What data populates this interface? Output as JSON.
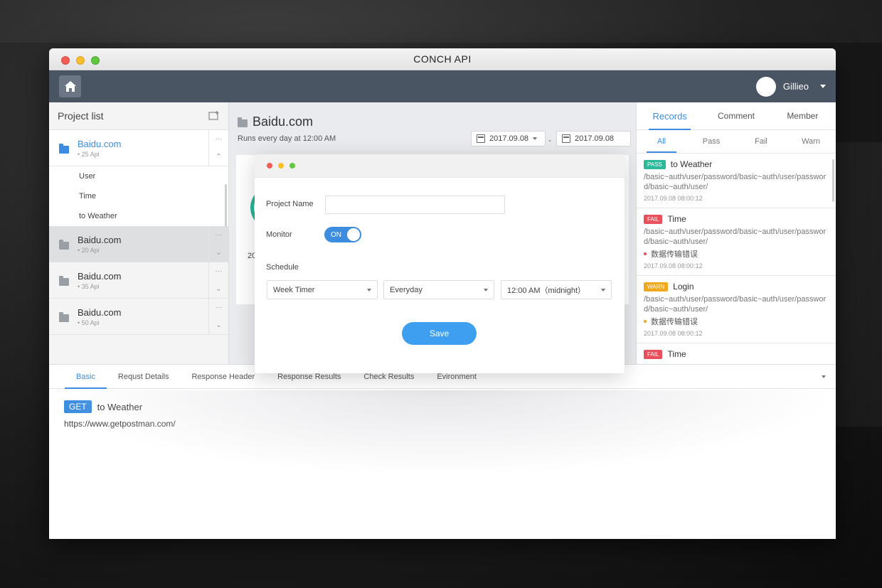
{
  "window": {
    "title": "CONCH API"
  },
  "appbar": {
    "user_name": "Gillieo"
  },
  "sidebar": {
    "title": "Project list",
    "projects": [
      {
        "name": "Baidu.com",
        "meta": "25 Api"
      },
      {
        "name": "Baidu.com",
        "meta": "20 Api"
      },
      {
        "name": "Baidu.com",
        "meta": "35 Api"
      },
      {
        "name": "Baidu.com",
        "meta": "50 Api"
      }
    ],
    "sub_items": [
      "User",
      "Time",
      "to Weather"
    ],
    "more_glyph": "···"
  },
  "main": {
    "title": "Baidu.com",
    "subtitle": "Runs every day at 12:00 AM",
    "date_from": "2017.09.08",
    "date_to": "2017.09.08",
    "date_separator": "-",
    "peek_text": "20"
  },
  "records": {
    "tabs": [
      "Records",
      "Comment",
      "Member"
    ],
    "filters": [
      "All",
      "Pass",
      "Fail",
      "Warn"
    ],
    "items": [
      {
        "badge": "PASS",
        "badge_color": "#2bb99a",
        "title": "to Weather",
        "path": "/basic~auth/user/password/basic~auth/user/password/basic~auth/user/",
        "error": "",
        "time": "2017.09.08   08:00:12"
      },
      {
        "badge": "FAIL",
        "badge_color": "#e8505b",
        "title": "Time",
        "path": "/basic~auth/user/password/basic~auth/user/password/basic~auth/user/",
        "error": "数据传输错误",
        "error_color": "#e8505b",
        "time": "2017.09.08   08:00:12"
      },
      {
        "badge": "WARN",
        "badge_color": "#f0a91e",
        "title": "Login",
        "path": "/basic~auth/user/password/basic~auth/user/password/basic~auth/user/",
        "error": "数据传输错误",
        "error_color": "#f0a91e",
        "time": "2017.09.08   08:00:12"
      },
      {
        "badge": "FAIL",
        "badge_color": "#e8505b",
        "title": "Time",
        "path": "",
        "error": "",
        "time": ""
      }
    ]
  },
  "bottom": {
    "tabs": [
      "Basic",
      "Requst Details",
      "Response Header",
      "Response Results",
      "Check Results",
      "Evironment"
    ],
    "method": "GET",
    "request_title": "to Weather",
    "url": "https://www.getpostman.com/"
  },
  "modal": {
    "project_name_label": "Project Name",
    "project_name_value": "",
    "monitor_label": "Monitor",
    "monitor_state": "ON",
    "schedule_label": "Schedule",
    "timer": "Week Timer",
    "frequency": "Everyday",
    "time": "12:00 AM（midnight）",
    "save_label": "Save"
  }
}
